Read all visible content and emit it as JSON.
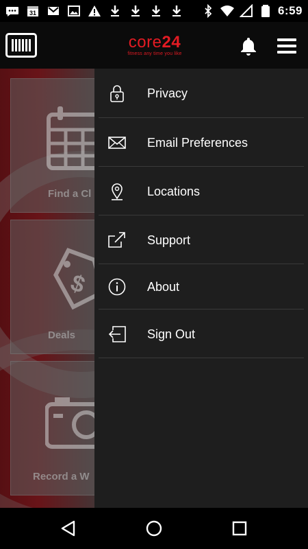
{
  "status_bar": {
    "time": "6:59",
    "calendar_day": "31",
    "left_icons": [
      "chat-icon",
      "calendar-icon",
      "gmail-icon",
      "image-icon",
      "warning-icon",
      "download-icon",
      "download-icon",
      "download-icon",
      "download-icon"
    ],
    "right_icons": [
      "bluetooth-icon",
      "wifi-icon",
      "signal-icon",
      "battery-icon"
    ]
  },
  "app_bar": {
    "logo_text": "core",
    "logo_number": "24",
    "logo_tagline": "fitness any time you like",
    "brand_color": "#e31b23"
  },
  "background_tiles": [
    {
      "label": "Find a Cl",
      "icon": "calendar-icon"
    },
    {
      "label": "Deals",
      "icon": "price-tag-icon"
    },
    {
      "label": "Record a W",
      "icon": "camera-icon"
    }
  ],
  "drawer": {
    "items": [
      {
        "label": "Privacy",
        "icon": "lock-icon"
      },
      {
        "label": "Email Preferences",
        "icon": "envelope-icon"
      },
      {
        "label": "Locations",
        "icon": "location-pin-icon"
      },
      {
        "label": "Support",
        "icon": "external-link-icon"
      },
      {
        "label": "About",
        "icon": "info-icon"
      },
      {
        "label": "Sign Out",
        "icon": "sign-out-icon"
      }
    ]
  },
  "nav_bar": {
    "buttons": [
      "back-icon",
      "home-icon",
      "recents-icon"
    ]
  }
}
